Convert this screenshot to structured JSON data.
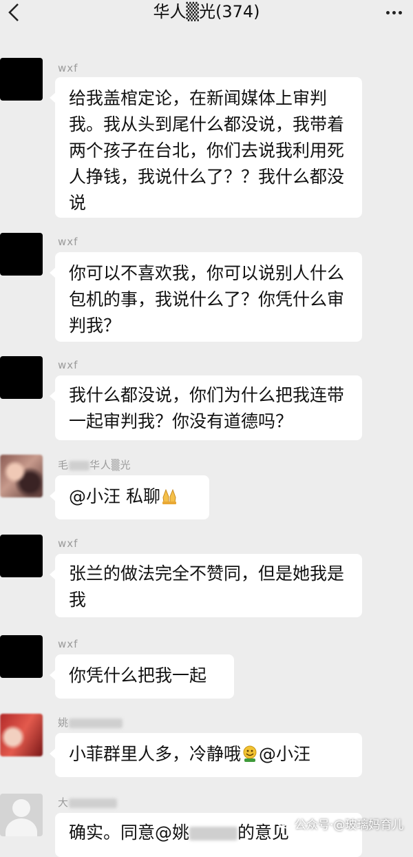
{
  "header": {
    "title": "华人▒光(374)",
    "back_icon": "chevron-left-icon",
    "more_icon": "more-dots-icon"
  },
  "messages": [
    {
      "sender": "wxf",
      "text": "给我盖棺定论，在新闻媒体上审判我。我从头到尾什么都没说，我带着两个孩子在台北，你们去说我利用死人挣钱，我说什么了？？我什么都没说"
    },
    {
      "sender": "wxf",
      "text": "你可以不喜欢我，你可以说别人什么包机的事，我说什么了？你凭什么审判我？"
    },
    {
      "sender": "wxf",
      "text": "我什么都没说，你们为什么把我连带一起审判我？你没有道德吗？"
    },
    {
      "sender_prefix": "毛",
      "sender_suffix": "华人▒光",
      "text_before_emoji": "@小汪  私聊",
      "emoji": "folded-hands-emoji"
    },
    {
      "sender": "wxf",
      "text": "张兰的做法完全不赞同，但是她我是我"
    },
    {
      "sender": "wxf",
      "text": "你凭什么把我一起"
    },
    {
      "sender_prefix": "姚",
      "text_before_emoji": "小菲群里人多，冷静哦",
      "emoji": "grinning-face-emoji",
      "text_after_emoji": "@小汪"
    },
    {
      "sender_prefix": "大",
      "text": "确实。同意@姚",
      "text_tail": "的意见"
    }
  ],
  "watermark": {
    "text": "公众号·@玻璃妈育儿"
  },
  "colors": {
    "background": "#ededed",
    "bubble": "#ffffff",
    "sender": "#9a9a9a"
  }
}
